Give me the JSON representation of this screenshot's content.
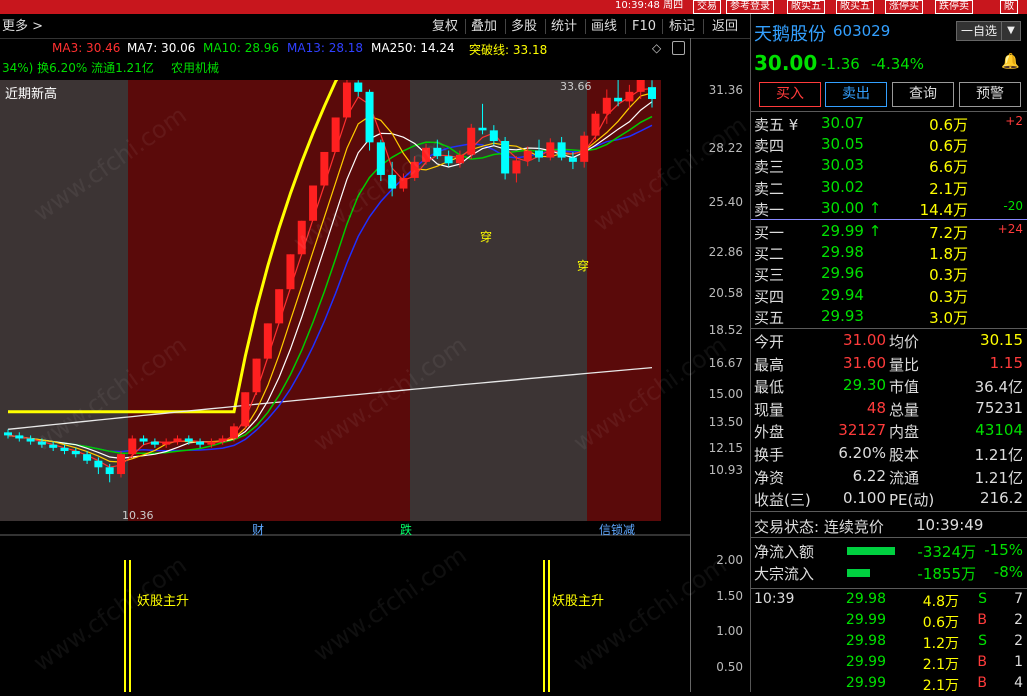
{
  "top": {
    "time": "10:39:48 周四",
    "buttons": [
      "交易",
      "参考登录",
      "敞实五",
      "敞买五",
      "涨停买",
      "跌停卖",
      "敞"
    ]
  },
  "toolbar": {
    "more": "更多 >",
    "items": [
      "复权",
      "叠加",
      "多股",
      "统计",
      "画线",
      "F10",
      "标记",
      "返回"
    ]
  },
  "indicators": {
    "ma3": "MA3: 30.46",
    "ma7": "MA7: 30.06",
    "ma10": "MA10: 28.96",
    "ma13": "MA13: 28.18",
    "ma250": "MA250: 14.24",
    "breakout": "突破线: 33.18",
    "line2": "34%) 换6.20% 流通1.21亿",
    "industry": "农用机械"
  },
  "chart": {
    "label_top": "近期新高",
    "high_label": "33.66",
    "low_label": "10.36",
    "marker_cai": "财",
    "marker_die": "跌",
    "marker_chuan1": "穿",
    "marker_chuan2": "穿",
    "marker_end": "信锁减",
    "y_ticks": [
      "31.36",
      "28.22",
      "25.40",
      "22.86",
      "20.58",
      "18.52",
      "16.67",
      "15.00",
      "13.50",
      "12.15",
      "10.93"
    ],
    "sub_label1": "妖股主升",
    "sub_label2": "妖股主升",
    "sub_ticks": [
      "2.00",
      "1.50",
      "1.00",
      "0.50"
    ],
    "watermark": "www.cfchi.com",
    "colors": {
      "up": "#ff2020",
      "down": "#00ffff",
      "bg_red": "#5a0a0a",
      "bg_gray": "#3c3434"
    }
  },
  "chart_data": {
    "type": "candlestick",
    "candles": [
      {
        "o": 11.9,
        "h": 12.0,
        "l": 11.7,
        "c": 11.8
      },
      {
        "o": 11.8,
        "h": 11.9,
        "l": 11.6,
        "c": 11.7
      },
      {
        "o": 11.7,
        "h": 11.8,
        "l": 11.5,
        "c": 11.6
      },
      {
        "o": 11.6,
        "h": 11.7,
        "l": 11.4,
        "c": 11.5
      },
      {
        "o": 11.5,
        "h": 11.6,
        "l": 11.3,
        "c": 11.4
      },
      {
        "o": 11.4,
        "h": 11.5,
        "l": 11.2,
        "c": 11.3
      },
      {
        "o": 11.3,
        "h": 11.4,
        "l": 11.1,
        "c": 11.2
      },
      {
        "o": 11.2,
        "h": 11.3,
        "l": 10.9,
        "c": 11.0
      },
      {
        "o": 11.0,
        "h": 11.1,
        "l": 10.6,
        "c": 10.8
      },
      {
        "o": 10.8,
        "h": 10.9,
        "l": 10.36,
        "c": 10.6
      },
      {
        "o": 10.6,
        "h": 11.3,
        "l": 10.5,
        "c": 11.2
      },
      {
        "o": 11.2,
        "h": 11.8,
        "l": 11.1,
        "c": 11.7
      },
      {
        "o": 11.7,
        "h": 11.8,
        "l": 11.5,
        "c": 11.6
      },
      {
        "o": 11.6,
        "h": 11.7,
        "l": 11.4,
        "c": 11.5
      },
      {
        "o": 11.5,
        "h": 11.7,
        "l": 11.4,
        "c": 11.6
      },
      {
        "o": 11.6,
        "h": 11.8,
        "l": 11.5,
        "c": 11.7
      },
      {
        "o": 11.7,
        "h": 11.8,
        "l": 11.5,
        "c": 11.6
      },
      {
        "o": 11.6,
        "h": 11.7,
        "l": 11.4,
        "c": 11.5
      },
      {
        "o": 11.5,
        "h": 11.7,
        "l": 11.4,
        "c": 11.6
      },
      {
        "o": 11.6,
        "h": 11.8,
        "l": 11.5,
        "c": 11.7
      },
      {
        "o": 11.7,
        "h": 12.2,
        "l": 11.6,
        "c": 12.1
      },
      {
        "o": 12.1,
        "h": 13.3,
        "l": 12.0,
        "c": 13.3
      },
      {
        "o": 13.3,
        "h": 14.6,
        "l": 13.2,
        "c": 14.6
      },
      {
        "o": 14.6,
        "h": 16.1,
        "l": 14.6,
        "c": 16.1
      },
      {
        "o": 16.1,
        "h": 17.7,
        "l": 16.1,
        "c": 17.7
      },
      {
        "o": 17.7,
        "h": 19.5,
        "l": 17.7,
        "c": 19.5
      },
      {
        "o": 19.5,
        "h": 21.4,
        "l": 19.5,
        "c": 21.4
      },
      {
        "o": 21.4,
        "h": 23.6,
        "l": 21.4,
        "c": 23.6
      },
      {
        "o": 23.6,
        "h": 25.9,
        "l": 23.6,
        "c": 25.9
      },
      {
        "o": 25.9,
        "h": 28.5,
        "l": 25.9,
        "c": 28.5
      },
      {
        "o": 28.5,
        "h": 33.66,
        "l": 28.5,
        "c": 31.4
      },
      {
        "o": 31.4,
        "h": 31.6,
        "l": 30.2,
        "c": 30.6
      },
      {
        "o": 30.6,
        "h": 30.8,
        "l": 26.0,
        "c": 26.6
      },
      {
        "o": 26.6,
        "h": 26.8,
        "l": 23.9,
        "c": 24.3
      },
      {
        "o": 24.3,
        "h": 25.2,
        "l": 22.9,
        "c": 23.4
      },
      {
        "o": 23.4,
        "h": 24.4,
        "l": 23.2,
        "c": 24.1
      },
      {
        "o": 24.1,
        "h": 25.6,
        "l": 23.9,
        "c": 25.2
      },
      {
        "o": 25.2,
        "h": 26.5,
        "l": 25.0,
        "c": 26.2
      },
      {
        "o": 26.2,
        "h": 26.8,
        "l": 25.4,
        "c": 25.6
      },
      {
        "o": 25.6,
        "h": 26.0,
        "l": 24.9,
        "c": 25.1
      },
      {
        "o": 25.1,
        "h": 26.0,
        "l": 24.8,
        "c": 25.7
      },
      {
        "o": 25.7,
        "h": 28.0,
        "l": 25.4,
        "c": 27.7
      },
      {
        "o": 27.7,
        "h": 29.6,
        "l": 27.2,
        "c": 27.5
      },
      {
        "o": 27.5,
        "h": 27.9,
        "l": 26.4,
        "c": 26.7
      },
      {
        "o": 26.7,
        "h": 27.0,
        "l": 24.0,
        "c": 24.4
      },
      {
        "o": 24.4,
        "h": 25.6,
        "l": 23.8,
        "c": 25.3
      },
      {
        "o": 25.3,
        "h": 26.3,
        "l": 24.9,
        "c": 26.0
      },
      {
        "o": 26.0,
        "h": 26.8,
        "l": 25.2,
        "c": 25.5
      },
      {
        "o": 25.5,
        "h": 26.9,
        "l": 25.3,
        "c": 26.6
      },
      {
        "o": 26.6,
        "h": 27.0,
        "l": 25.3,
        "c": 25.5
      },
      {
        "o": 25.5,
        "h": 25.9,
        "l": 24.7,
        "c": 25.2
      },
      {
        "o": 25.2,
        "h": 27.4,
        "l": 24.8,
        "c": 27.1
      },
      {
        "o": 27.1,
        "h": 29.0,
        "l": 26.8,
        "c": 28.8
      },
      {
        "o": 28.8,
        "h": 30.8,
        "l": 28.0,
        "c": 30.1
      },
      {
        "o": 30.1,
        "h": 32.4,
        "l": 29.4,
        "c": 29.8
      },
      {
        "o": 29.8,
        "h": 31.2,
        "l": 29.2,
        "c": 30.6
      },
      {
        "o": 30.6,
        "h": 32.6,
        "l": 30.0,
        "c": 32.0
      },
      {
        "o": 31.0,
        "h": 31.6,
        "l": 29.3,
        "c": 30.0
      }
    ],
    "ma250": [
      12.0,
      14.24
    ]
  },
  "quote": {
    "name": "天鹅股份",
    "code": "603029",
    "add": "一自选",
    "price": "30.00",
    "change": "-1.36",
    "pct": "-4.34%",
    "buttons": [
      "买入",
      "卖出",
      "查询",
      "预警"
    ],
    "asks": [
      {
        "label": "卖五 ¥",
        "price": "30.07",
        "vol": "0.6万",
        "chg": "+2"
      },
      {
        "label": "卖四",
        "price": "30.05",
        "vol": "0.6万",
        "chg": ""
      },
      {
        "label": "卖三",
        "price": "30.03",
        "vol": "6.6万",
        "chg": ""
      },
      {
        "label": "卖二",
        "price": "30.02",
        "vol": "2.1万",
        "chg": ""
      },
      {
        "label": "卖一",
        "price": "30.00 ↑",
        "vol": "14.4万",
        "chg": "-20"
      }
    ],
    "bids": [
      {
        "label": "买一",
        "price": "29.99 ↑",
        "vol": "7.2万",
        "chg": "+24"
      },
      {
        "label": "买二",
        "price": "29.98",
        "vol": "1.8万",
        "chg": ""
      },
      {
        "label": "买三",
        "price": "29.96",
        "vol": "0.3万",
        "chg": ""
      },
      {
        "label": "买四",
        "price": "29.94",
        "vol": "0.3万",
        "chg": ""
      },
      {
        "label": "买五",
        "price": "29.93",
        "vol": "3.0万",
        "chg": ""
      }
    ],
    "stats": [
      {
        "l1": "今开",
        "v1": "31.00",
        "l2": "均价",
        "v2": "30.15",
        "c1": "red",
        "c2": "yellow"
      },
      {
        "l1": "最高",
        "v1": "31.60",
        "l2": "量比",
        "v2": "1.15",
        "c1": "red",
        "c2": "red"
      },
      {
        "l1": "最低",
        "v1": "29.30",
        "l2": "市值",
        "v2": "36.4亿",
        "c1": "green",
        "c2": "white"
      },
      {
        "l1": "现量",
        "v1": "48",
        "l2": "总量",
        "v2": "75231",
        "c1": "red",
        "c2": "white"
      },
      {
        "l1": "外盘",
        "v1": "32127",
        "l2": "内盘",
        "v2": "43104",
        "c1": "red",
        "c2": "green"
      },
      {
        "l1": "换手",
        "v1": "6.20%",
        "l2": "股本",
        "v2": "1.21亿",
        "c1": "white",
        "c2": "white"
      },
      {
        "l1": "净资",
        "v1": "6.22",
        "l2": "流通",
        "v2": "1.21亿",
        "c1": "white",
        "c2": "white"
      },
      {
        "l1": "收益(三)",
        "v1": "0.100",
        "l2": "PE(动)",
        "v2": "216.2",
        "c1": "white",
        "c2": "white"
      }
    ],
    "trade_state": "交易状态: 连续竞价",
    "trade_time": "10:39:49",
    "flows": [
      {
        "label": "净流入额",
        "val": "-3324万",
        "pct": "-15%",
        "bar": 0.8
      },
      {
        "label": "大宗流入",
        "val": "-1855万",
        "pct": "-8%",
        "bar": 0.38
      }
    ],
    "ticks": [
      {
        "time": "10:39",
        "price": "29.98",
        "vol": "4.8万",
        "bs": "S",
        "n": "7"
      },
      {
        "time": "",
        "price": "29.99",
        "vol": "0.6万",
        "bs": "B",
        "n": "2"
      },
      {
        "time": "",
        "price": "29.98",
        "vol": "1.2万",
        "bs": "S",
        "n": "2"
      },
      {
        "time": "",
        "price": "29.99",
        "vol": "2.1万",
        "bs": "B",
        "n": "1"
      },
      {
        "time": "",
        "price": "29.99",
        "vol": "2.1万",
        "bs": "B",
        "n": "4"
      }
    ]
  }
}
